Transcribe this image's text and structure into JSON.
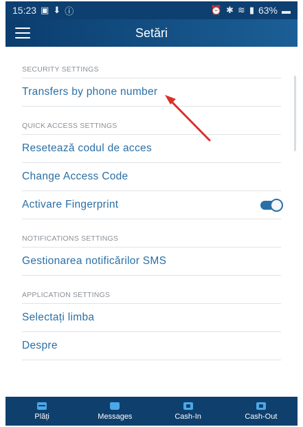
{
  "status_bar": {
    "time": "15:23",
    "battery": "63%"
  },
  "app_bar": {
    "title": "Setări"
  },
  "sections": [
    {
      "header": "SECURITY SETTINGS",
      "items": [
        "Transfers by phone number"
      ]
    },
    {
      "header": "QUICK ACCESS SETTINGS",
      "items": [
        "Resetează codul de acces",
        "Change Access Code",
        "Activare Fingerprint"
      ]
    },
    {
      "header": "NOTIFICATIONS SETTINGS",
      "items": [
        "Gestionarea notificărilor SMS"
      ]
    },
    {
      "header": "APPLICATION SETTINGS",
      "items": [
        "Selectați limba",
        "Despre"
      ]
    }
  ],
  "fingerprint_toggle": {
    "state": "on"
  },
  "bottom_nav": [
    {
      "label": "Plăți",
      "icon": "wallet-icon"
    },
    {
      "label": "Messages",
      "icon": "envelope-icon"
    },
    {
      "label": "Cash-In",
      "icon": "cash-in-icon"
    },
    {
      "label": "Cash-Out",
      "icon": "cash-out-icon"
    }
  ],
  "colors": {
    "primary": "#0d3f70",
    "link": "#2a6fa6",
    "annotation": "#d9302a"
  }
}
